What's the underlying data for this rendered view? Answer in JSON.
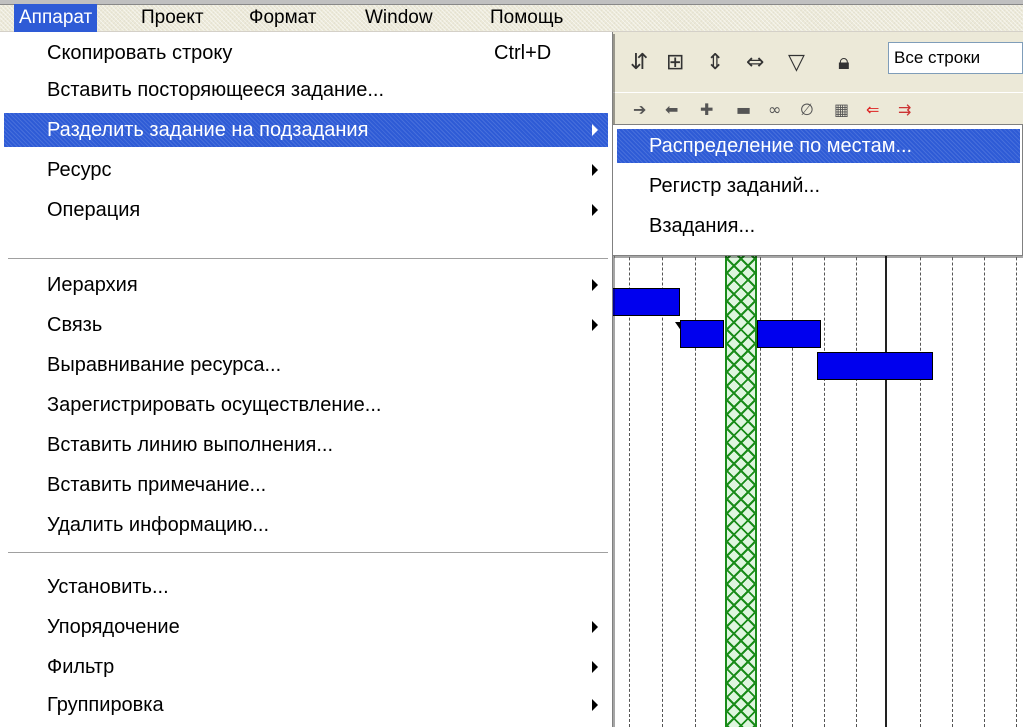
{
  "menubar": {
    "items": [
      "Аппарат",
      "Проект",
      "Формат",
      "Window",
      "Помощь"
    ]
  },
  "toolbar": {
    "filter_value": "Все строки"
  },
  "menu": {
    "items": [
      {
        "label": "Скопировать строку",
        "shortcut": "Ctrl+D"
      },
      {
        "label": "Вставить посторяющееся задание..."
      },
      {
        "label": "Разделить задание на подзадания",
        "submenu": true,
        "highlighted": true
      },
      {
        "label": "Ресурс",
        "submenu": true
      },
      {
        "label": "Операция",
        "submenu": true
      },
      {
        "label": "Иерархия",
        "submenu": true
      },
      {
        "label": "Связь",
        "submenu": true
      },
      {
        "label": "Выравнивание ресурса..."
      },
      {
        "label": "Зарегистрировать осуществление..."
      },
      {
        "label": "Вставить линию выполнения..."
      },
      {
        "label": "Вставить примечание..."
      },
      {
        "label": "Удалить информацию..."
      },
      {
        "label": "Установить..."
      },
      {
        "label": "Упорядочение",
        "submenu": true
      },
      {
        "label": "Фильтр",
        "submenu": true
      },
      {
        "label": "Группировка",
        "submenu": true
      }
    ]
  },
  "submenu": {
    "items": [
      {
        "label": "Распределение по местам...",
        "highlighted": true
      },
      {
        "label": "Регистр заданий..."
      },
      {
        "label": "Взадания..."
      }
    ]
  },
  "colors": {
    "highlight": "#2e5bd6",
    "task_bar": "#0000ee",
    "progress_line": "#1a8c1a"
  }
}
